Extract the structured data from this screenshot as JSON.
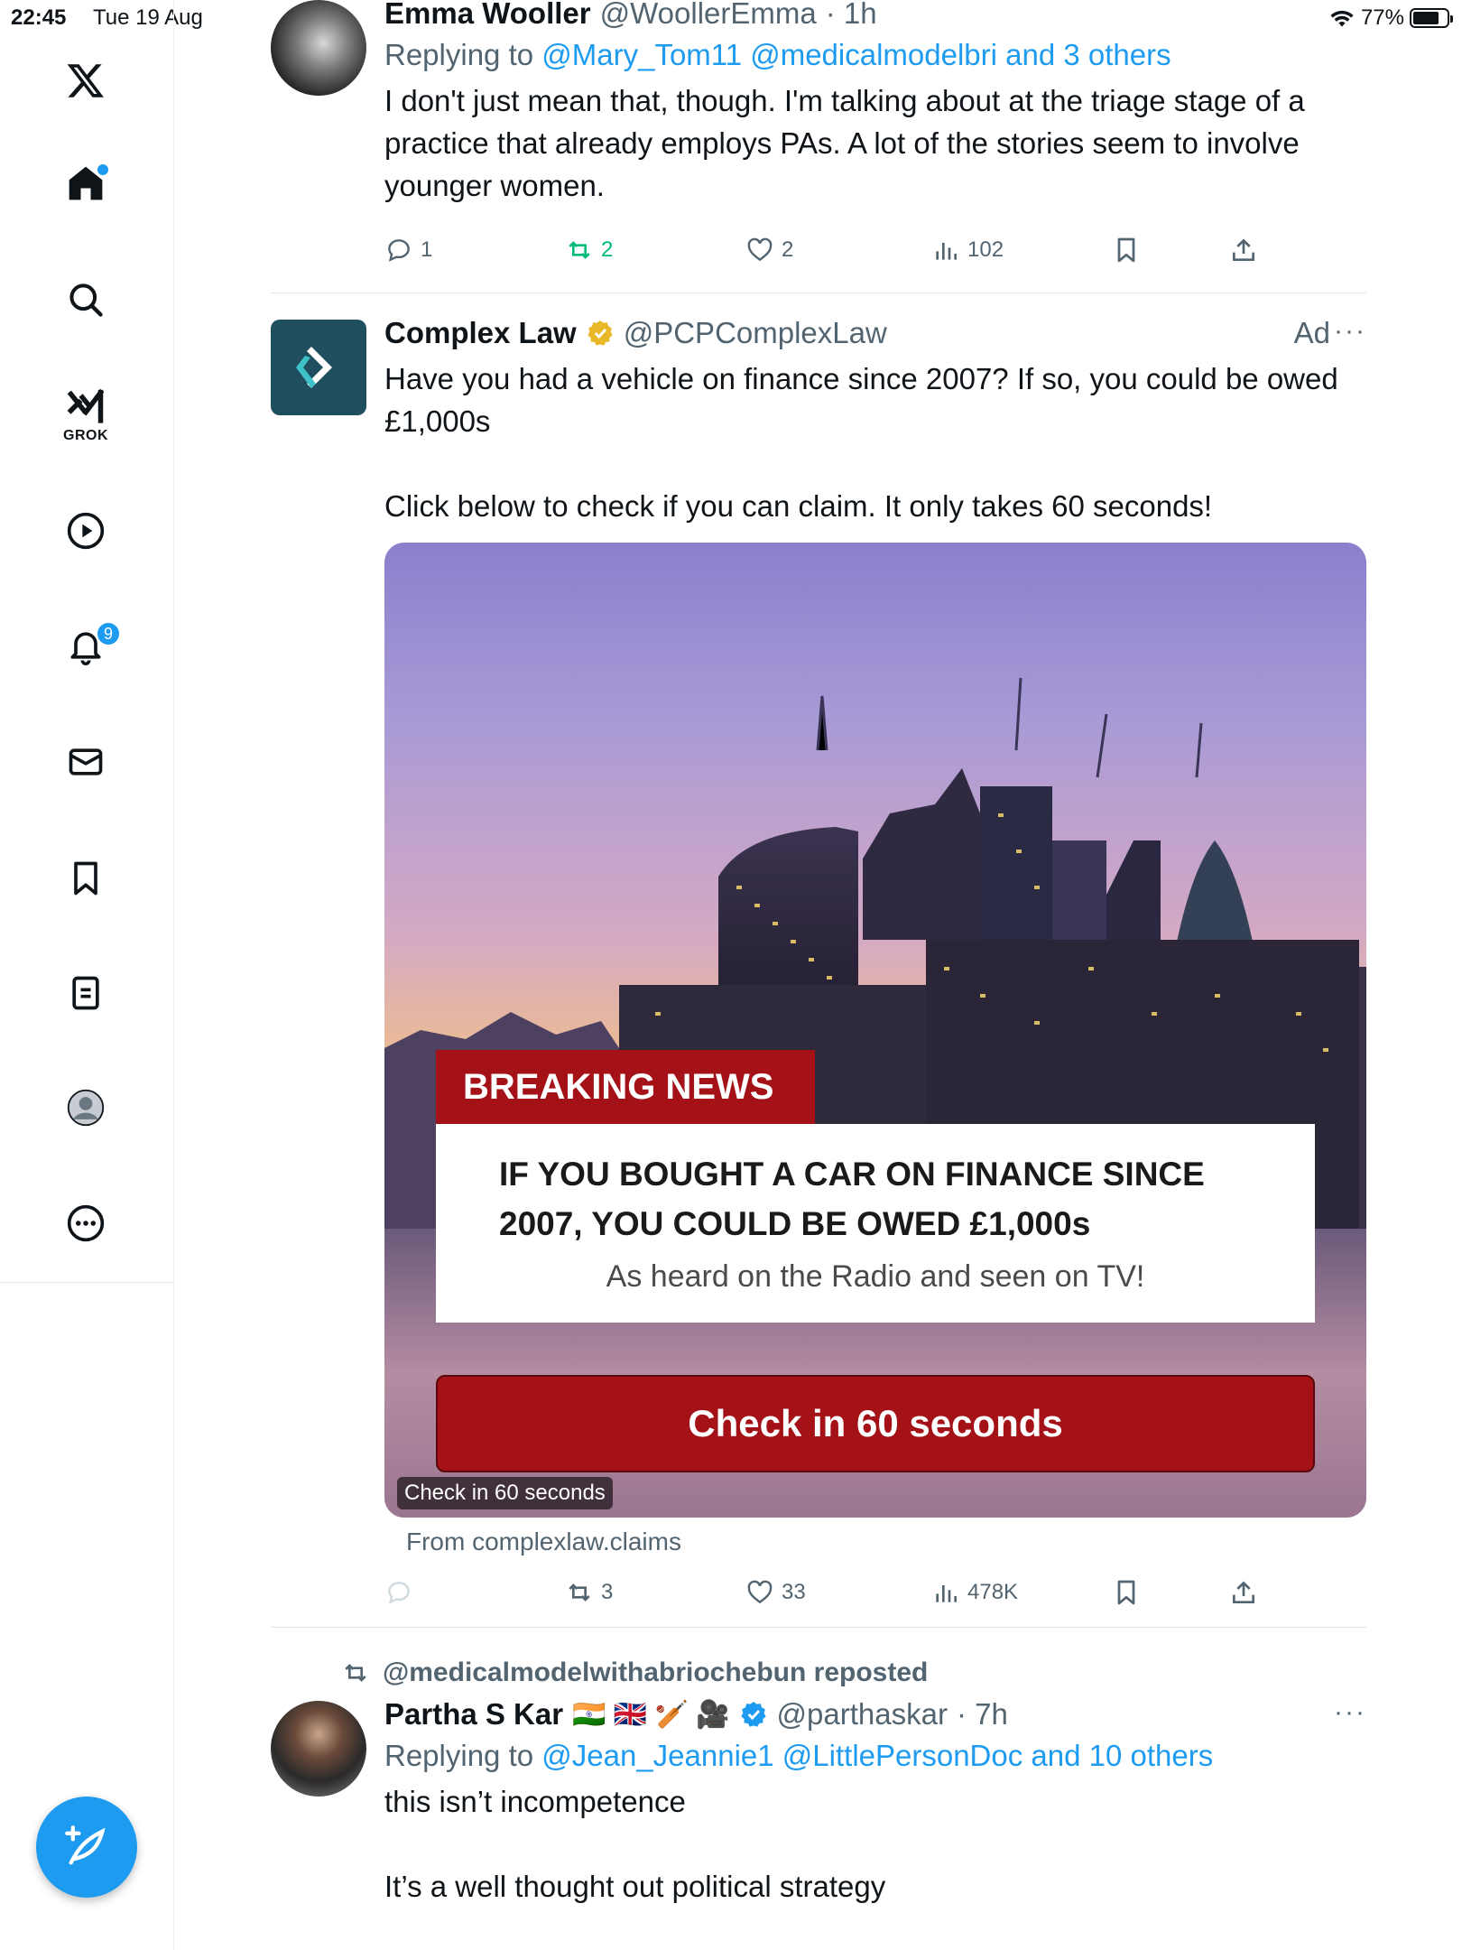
{
  "status_bar": {
    "time": "22:45",
    "date": "Tue 19 Aug",
    "battery": "77%",
    "battery_level": 0.77
  },
  "sidebar": {
    "items": [
      {
        "icon": "x-logo-icon",
        "label": "X"
      },
      {
        "icon": "home-icon",
        "label": "Home",
        "has_dot": true
      },
      {
        "icon": "search-icon",
        "label": "Explore"
      },
      {
        "icon": "grok-icon",
        "label": "GROK"
      },
      {
        "icon": "play-icon",
        "label": "Video"
      },
      {
        "icon": "bell-icon",
        "label": "Notifications",
        "badge": "9"
      },
      {
        "icon": "mail-icon",
        "label": "Messages"
      },
      {
        "icon": "bookmark-icon",
        "label": "Bookmarks"
      },
      {
        "icon": "document-icon",
        "label": "Lists"
      },
      {
        "icon": "profile-icon",
        "label": "Profile"
      },
      {
        "icon": "more-circle-icon",
        "label": "More"
      }
    ],
    "grok_label": "GROK",
    "notification_badge": "9",
    "compose_icon": "compose-icon"
  },
  "tweets": [
    {
      "name": "Emma Wooller",
      "handle": "@WoollerEmma",
      "time": "· 1h",
      "replying_prefix": "Replying to ",
      "replying_links": "@Mary_Tom11 @medicalmodelbri and 3 others",
      "text": "I don't just mean that, though. I'm talking about at the triage stage of a practice that already employs PAs. A lot of the stories seem to involve younger women.",
      "stats": {
        "replies": "1",
        "reposts": "2",
        "likes": "2",
        "views": "102"
      }
    },
    {
      "name": "Complex Law",
      "handle": "@PCPComplexLaw",
      "ad_label": "Ad",
      "more": "···",
      "text_line1": "Have you had a vehicle on finance since 2007? If so, you could be owed £1,000s",
      "text_line2": "Click below to check if you can claim. It only takes 60 seconds!",
      "ad": {
        "breaking": "BREAKING NEWS",
        "headline": "IF YOU BOUGHT A CAR ON FINANCE SINCE 2007, YOU COULD BE OWED £1,000s",
        "subhead": "As heard on the Radio and seen on TV!",
        "cta": "Check in 60 seconds",
        "chip": "Check in 60 seconds",
        "from": "From complexlaw.claims"
      },
      "stats": {
        "reposts": "3",
        "likes": "33",
        "views": "478K"
      }
    },
    {
      "repost_by": "@medicalmodelwithabriochebun reposted",
      "name": "Partha S Kar",
      "emojis": "🇮🇳 🇬🇧 🏏 🎥",
      "handle": "@parthaskar",
      "time": "· 7h",
      "more": "···",
      "replying_prefix": "Replying to ",
      "replying_links": "@Jean_Jeannie1 @LittlePersonDoc and 10 others",
      "text_line1": "this isn’t incompetence",
      "text_line2": "It’s a well thought out political strategy"
    }
  ],
  "colors": {
    "accent": "#1d9bf0",
    "repost_green": "#00ba7c",
    "ad_red": "#a41117",
    "muted": "#536471"
  }
}
